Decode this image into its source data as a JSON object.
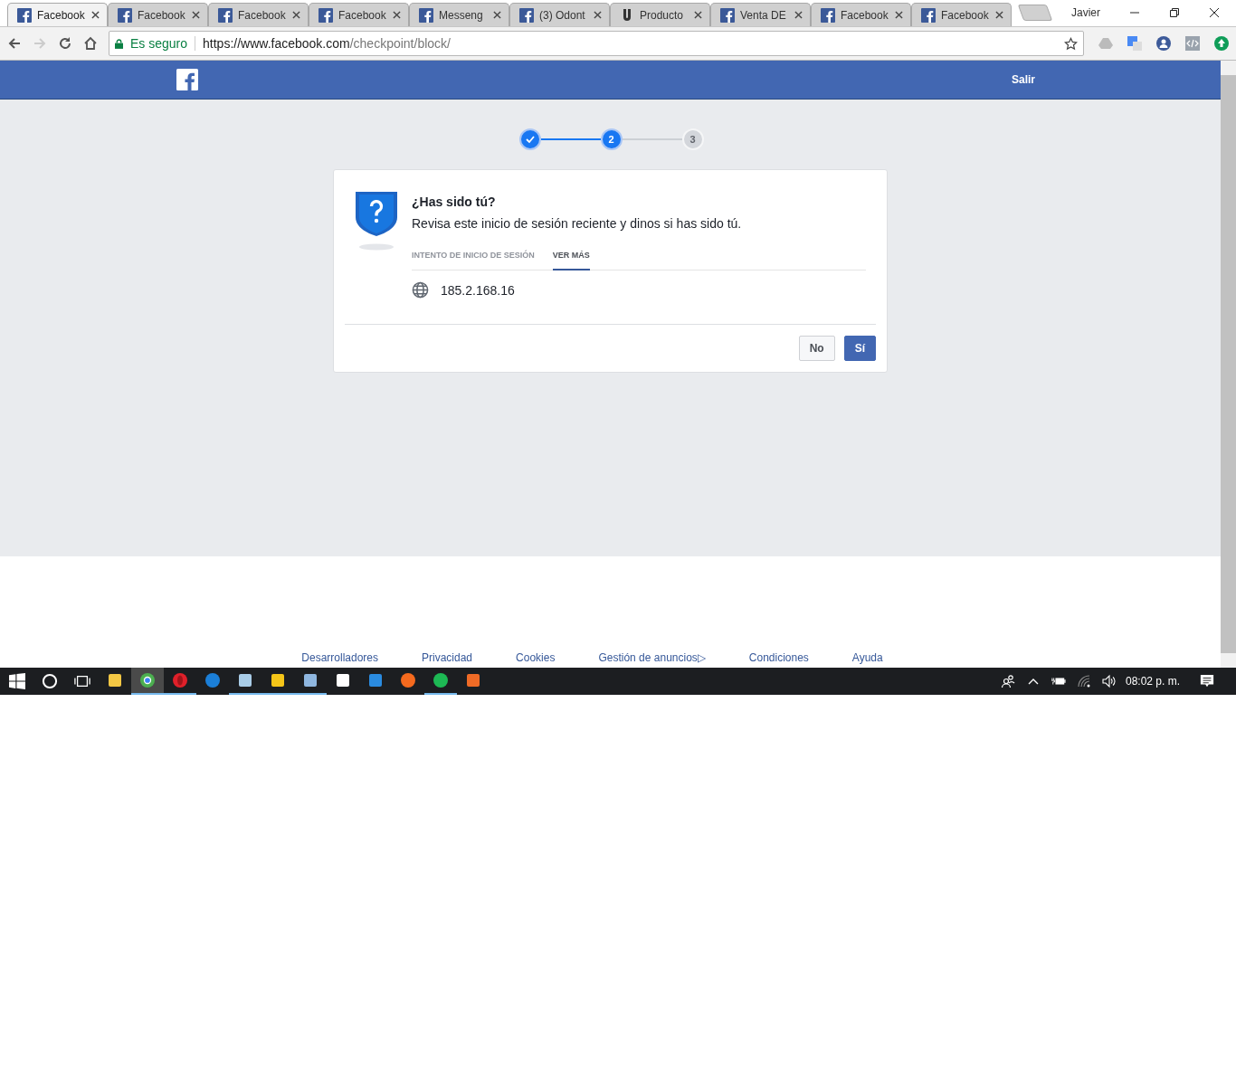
{
  "browser": {
    "tabs": [
      {
        "title": "Facebook",
        "kind": "fb",
        "selected": true
      },
      {
        "title": "Facebook",
        "kind": "fb",
        "selected": false
      },
      {
        "title": "Facebook",
        "kind": "fb",
        "selected": false
      },
      {
        "title": "Facebook",
        "kind": "fb",
        "selected": false
      },
      {
        "title": "Messeng",
        "kind": "fb",
        "selected": false
      },
      {
        "title": "(3) Odont",
        "kind": "fb",
        "selected": false
      },
      {
        "title": "Producto",
        "kind": "u",
        "selected": false
      },
      {
        "title": "Venta DE",
        "kind": "fb",
        "selected": false
      },
      {
        "title": "Facebook",
        "kind": "fb",
        "selected": false
      },
      {
        "title": "Facebook",
        "kind": "fb",
        "selected": false
      }
    ],
    "profile": "Javier",
    "security": "Es seguro",
    "url_host": "https://www.facebook.com",
    "url_path": "/checkpoint/block/"
  },
  "header": {
    "logout": "Salir"
  },
  "steps": [
    {
      "kind": "done"
    },
    {
      "label": "2",
      "kind": "current"
    },
    {
      "label": "3",
      "kind": "pending"
    }
  ],
  "card": {
    "title": "¿Has sido tú?",
    "text": "Revisa este inicio de sesión reciente y dinos si has sido tú.",
    "tabs": [
      {
        "label": "INTENTO DE INICIO DE SESIÓN",
        "selected": false
      },
      {
        "label": "VER MÁS",
        "selected": true
      }
    ],
    "ip": "185.2.168.16",
    "buttons": [
      {
        "label": "No",
        "kind": "secondary"
      },
      {
        "label": "Sí",
        "kind": "primary"
      }
    ]
  },
  "footer": {
    "links": [
      "Desarrolladores",
      "Privacidad",
      "Cookies",
      "Gestión de anuncios▷",
      "Condiciones",
      "Ayuda"
    ]
  },
  "taskbar": {
    "apps": [
      {
        "kind": "explorer",
        "running": false,
        "selected": false
      },
      {
        "kind": "chrome",
        "running": true,
        "selected": true
      },
      {
        "kind": "opera",
        "running": true,
        "selected": false
      },
      {
        "kind": "edge",
        "running": false,
        "selected": false
      },
      {
        "kind": "notepad",
        "running": true,
        "selected": false
      },
      {
        "kind": "sticky",
        "running": true,
        "selected": false
      },
      {
        "kind": "paint",
        "running": true,
        "selected": false
      },
      {
        "kind": "calculator",
        "running": false,
        "selected": false
      },
      {
        "kind": "umbrella",
        "running": false,
        "selected": false
      },
      {
        "kind": "firefox",
        "running": false,
        "selected": false
      },
      {
        "kind": "spotify",
        "running": true,
        "selected": false
      },
      {
        "kind": "uc",
        "running": false,
        "selected": false
      }
    ],
    "time": "08:02 p. m."
  }
}
